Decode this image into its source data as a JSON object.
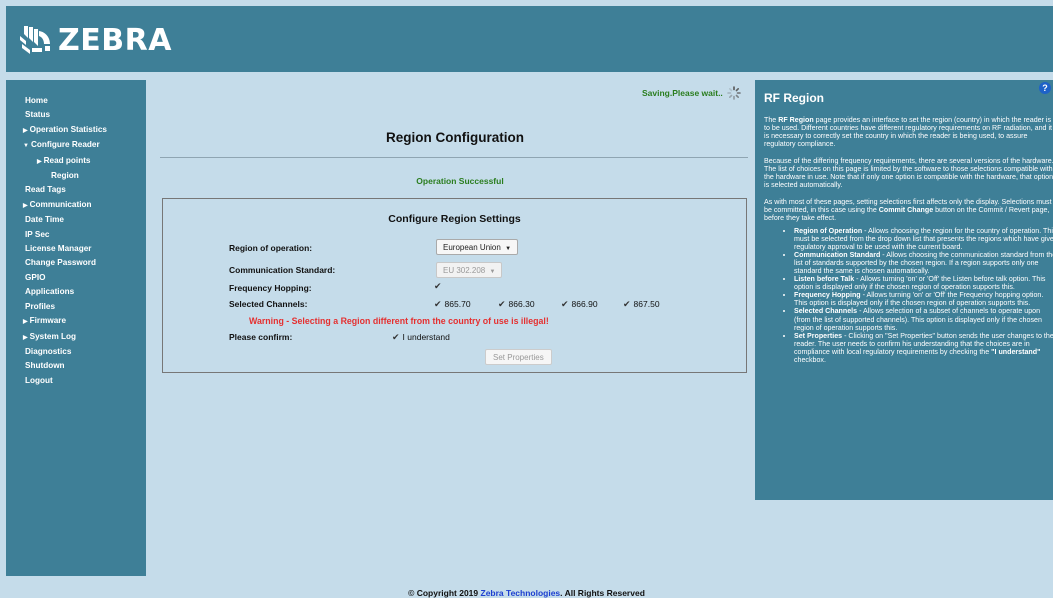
{
  "header": {
    "brand": "ZEBRA"
  },
  "sidebar": {
    "items": [
      {
        "label": "Home"
      },
      {
        "label": "Status"
      },
      {
        "label": "Operation Statistics",
        "marker": "▶"
      },
      {
        "label": "Configure Reader",
        "marker": "▼"
      },
      {
        "label": "Read points",
        "marker": "▶"
      },
      {
        "label": "Region"
      },
      {
        "label": "Read Tags"
      },
      {
        "label": "Communication",
        "marker": "▶"
      },
      {
        "label": "Date Time"
      },
      {
        "label": "IP Sec"
      },
      {
        "label": "License Manager"
      },
      {
        "label": "Change Password"
      },
      {
        "label": "GPIO"
      },
      {
        "label": "Applications"
      },
      {
        "label": "Profiles"
      },
      {
        "label": "Firmware",
        "marker": "▶"
      },
      {
        "label": "System Log",
        "marker": "▶"
      },
      {
        "label": "Diagnostics"
      },
      {
        "label": "Shutdown"
      },
      {
        "label": "Logout"
      }
    ]
  },
  "main": {
    "saving": "Saving.Please wait..",
    "title": "Region Configuration",
    "success": "Operation Successful",
    "panel": {
      "title": "Configure Region Settings",
      "region_label": "Region of operation:",
      "region_value": "European Union",
      "standard_label": "Communication Standard:",
      "standard_value": "EU 302.208",
      "hopping_label": "Frequency Hopping:",
      "channels_label": "Selected Channels:",
      "channels": [
        "865.70",
        "866.30",
        "866.90",
        "867.50"
      ],
      "warning": "Warning - Selecting a Region different from the country of use is illegal!",
      "confirm_label": "Please confirm:",
      "understand": "I understand",
      "set_button": "Set Properties"
    }
  },
  "help": {
    "title": "RF Region",
    "q": "?",
    "p1_a": "The ",
    "p1_b": "RF Region",
    "p1_c": " page provides an interface to set the region (country) in which the reader is to be used. Different countries have different regulatory requirements on RF radiation, and it is necessary to correctly set the country in which the reader is being used, to assure regulatory compliance.",
    "p2": "Because of the differing frequency requirements, there are several versions of the hardware. The list of choices on this page is limited by the software to those selections compatible with the hardware in use. Note that if only one option is compatible with the hardware, that option is selected automatically.",
    "p3_a": "As with most of these pages, setting selections first affects only the display. Selections must be committed, in this case using the ",
    "p3_b": "Commit Change",
    "p3_c": " button on the Commit / Revert page, before they take effect.",
    "b1_t": "Region of Operation",
    "b1": " - Allows choosing the region for the country of operation. This must be selected from the drop down list that presents the regions which have given regulatory approval to be used with the current board.",
    "b2_t": "Communication Standard",
    "b2": " - Allows choosing the communication standard from the list of standards supported by the chosen region. If a region supports only one standard the same is chosen automatically.",
    "b3_t": "Listen before Talk",
    "b3": " - Allows turning 'on' or 'Off' the Listen before talk option. This option is displayed only if the chosen region of operation supports this.",
    "b4_t": "Frequency Hopping",
    "b4": " - Allows turning 'on' or 'Off' the Frequency hopping option. This option is displayed only if the chosen region of operation supports this.",
    "b5_t": "Selected Channels",
    "b5": " - Allows selection of a subset of channels to operate upon (from the list of supported channels). This option is displayed only if the chosen region of operation supports this.",
    "b6_t": "Set Properties",
    "b6": " - Clicking on \"Set Properties\" button sends the user changes to the reader. The user needs to confirm his understanding that the choices are in compliance with local regulatory requirements by checking the ",
    "b6_b": "\"I understand\"",
    "b6_c": " checkbox."
  },
  "footer": {
    "pre": "© Copyright 2019 ",
    "link": "Zebra Technologies",
    "post": ". All Rights Reserved"
  }
}
